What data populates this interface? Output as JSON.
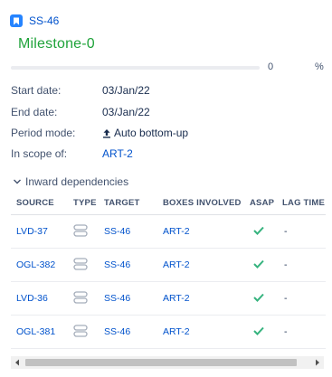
{
  "issue": {
    "key": "SS-46",
    "icon": "issue-type-icon",
    "color": "#2684ff"
  },
  "milestone": {
    "title": "Milestone-0",
    "title_color": "#1fa33a",
    "progress": 0,
    "progress_value": "0",
    "progress_unit": "%"
  },
  "fields": {
    "start_date": {
      "label": "Start date:",
      "value": "03/Jan/22"
    },
    "end_date": {
      "label": "End date:",
      "value": "03/Jan/22"
    },
    "period_mode": {
      "label": "Period mode:",
      "value": "Auto bottom-up",
      "icon": "arrow-up-bar-icon"
    },
    "in_scope_of": {
      "label": "In scope of:",
      "value": "ART-2"
    }
  },
  "dependencies": {
    "section_label": "Inward dependencies",
    "columns": {
      "source": "SOURCE",
      "type": "TYPE",
      "target": "TARGET",
      "boxes": "BOXES INVOLVED",
      "asap": "ASAP",
      "lag": "LAG TIME"
    },
    "rows": [
      {
        "source": "LVD-37",
        "type_icon": "link-type-icon",
        "target": "SS-46",
        "boxes": "ART-2",
        "asap": true,
        "lag": "-"
      },
      {
        "source": "OGL-382",
        "type_icon": "link-type-icon",
        "target": "SS-46",
        "boxes": "ART-2",
        "asap": true,
        "lag": "-"
      },
      {
        "source": "LVD-36",
        "type_icon": "link-type-icon",
        "target": "SS-46",
        "boxes": "ART-2",
        "asap": true,
        "lag": "-"
      },
      {
        "source": "OGL-381",
        "type_icon": "link-type-icon",
        "target": "SS-46",
        "boxes": "ART-2",
        "asap": true,
        "lag": "-"
      }
    ]
  },
  "colors": {
    "link": "#0052cc",
    "check": "#36b37e",
    "text": "#42526e"
  }
}
